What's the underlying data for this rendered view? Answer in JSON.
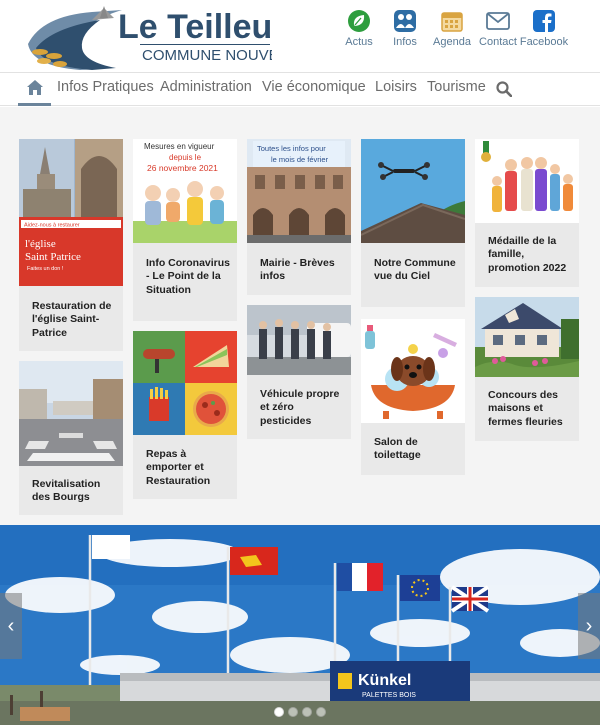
{
  "header": {
    "logo_title": "Le Teilleul",
    "logo_subtitle": "COMMUNE NOUVELLE",
    "icons": [
      {
        "label": "Actus",
        "icon": "leaf-icon",
        "color": "#2e9e3e"
      },
      {
        "label": "Infos",
        "icon": "info-people-icon",
        "color": "#2e6da4"
      },
      {
        "label": "Agenda",
        "icon": "calendar-icon",
        "color": "#d9a441"
      },
      {
        "label": "Contact",
        "icon": "envelope-icon",
        "color": "#5a7a95"
      },
      {
        "label": "Facebook",
        "icon": "facebook-icon",
        "color": "#1b6fc9"
      }
    ]
  },
  "nav": {
    "home_icon": "home-icon",
    "items": [
      "Infos Pratiques",
      "Administration",
      "Vie économique",
      "Loisirs",
      "Tourisme"
    ],
    "search_icon": "search-icon"
  },
  "cards": [
    {
      "caption": "Restauration de l'église Saint-Patrice",
      "poster_lines": [
        "Aidez-nous à restaurer",
        "l'église",
        "Saint Patrice",
        "Faites un don !"
      ]
    },
    {
      "caption": "Revitalisation des Bourgs"
    },
    {
      "caption": "Info Coronavirus - Le Point de la Situation",
      "poster_lines": [
        "Mesures en vigueur",
        "depuis le",
        "26 novembre 2021"
      ]
    },
    {
      "caption": "Repas à emporter et Restauration"
    },
    {
      "caption": "Mairie - Brèves infos",
      "poster_lines": [
        "Toutes les infos pour",
        "le mois de février"
      ]
    },
    {
      "caption": "Véhicule propre et zéro pesticides"
    },
    {
      "caption": "Notre Commune vue du Ciel"
    },
    {
      "caption": "Salon de toilettage"
    },
    {
      "caption": "Médaille de la famille, promotion 2022"
    },
    {
      "caption": "Concours des maisons et fermes fleuries"
    }
  ],
  "banner": {
    "sign_brand": "Künkel",
    "sign_sub": "PALETTES BOIS",
    "prev": "‹",
    "next": "›",
    "dots": 4
  },
  "colors": {
    "nav_text": "#6c6c6c",
    "accent": "#6b849b",
    "caption": "#222222"
  }
}
